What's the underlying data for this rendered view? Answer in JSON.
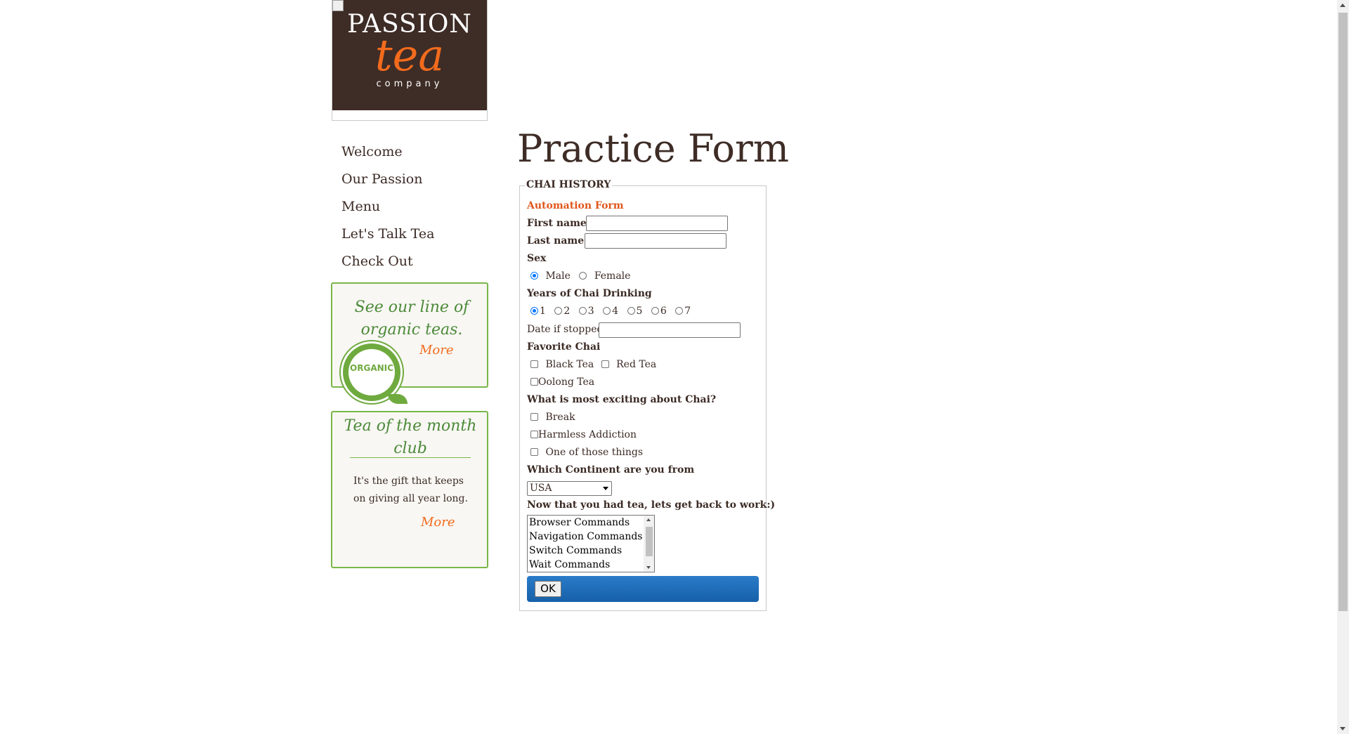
{
  "logo": {
    "line1": "PASSION",
    "line2": "tea",
    "line3": "company"
  },
  "nav": {
    "items": [
      "Welcome",
      "Our Passion",
      "Menu",
      "Let's Talk Tea",
      "Check Out"
    ]
  },
  "organic_box": {
    "text": "See our line of organic teas.",
    "more": "More",
    "seal_text": "ORGANIC"
  },
  "club_box": {
    "title": "Tea of the month club",
    "text": "It's the gift that keeps on giving all year long.",
    "more": "More"
  },
  "page_title": "Practice Form",
  "form": {
    "legend": "CHAI HISTORY",
    "subtitle": "Automation Form",
    "first_name_label": "First name:",
    "first_name_value": "",
    "last_name_label": "Last name:",
    "last_name_value": "",
    "sex_label": "Sex",
    "sex_options": [
      "Male",
      "Female"
    ],
    "sex_selected": "Male",
    "years_label": "Years of Chai Drinking",
    "years_options": [
      "1",
      "2",
      "3",
      "4",
      "5",
      "6",
      "7"
    ],
    "years_selected": "1",
    "date_label": "Date if stopped",
    "date_value": "",
    "favorite_label": "Favorite Chai",
    "favorite_options": [
      "Black Tea",
      "Red Tea",
      "Oolong Tea"
    ],
    "exciting_label": "What is most exciting about Chai?",
    "exciting_options": [
      "Break",
      "Harmless Addiction",
      "One of those things"
    ],
    "continent_label": "Which Continent are you from",
    "continent_selected": "USA",
    "commands_label": "Now that you had tea, lets get back to work:)",
    "commands_options": [
      "Browser Commands",
      "Navigation Commands",
      "Switch Commands",
      "Wait Commands"
    ],
    "ok_label": "OK"
  },
  "colors": {
    "brand_brown": "#3e2c26",
    "accent_orange": "#f26b1d",
    "box_green": "#7ab648",
    "button_blue": "#1f6fbf"
  }
}
